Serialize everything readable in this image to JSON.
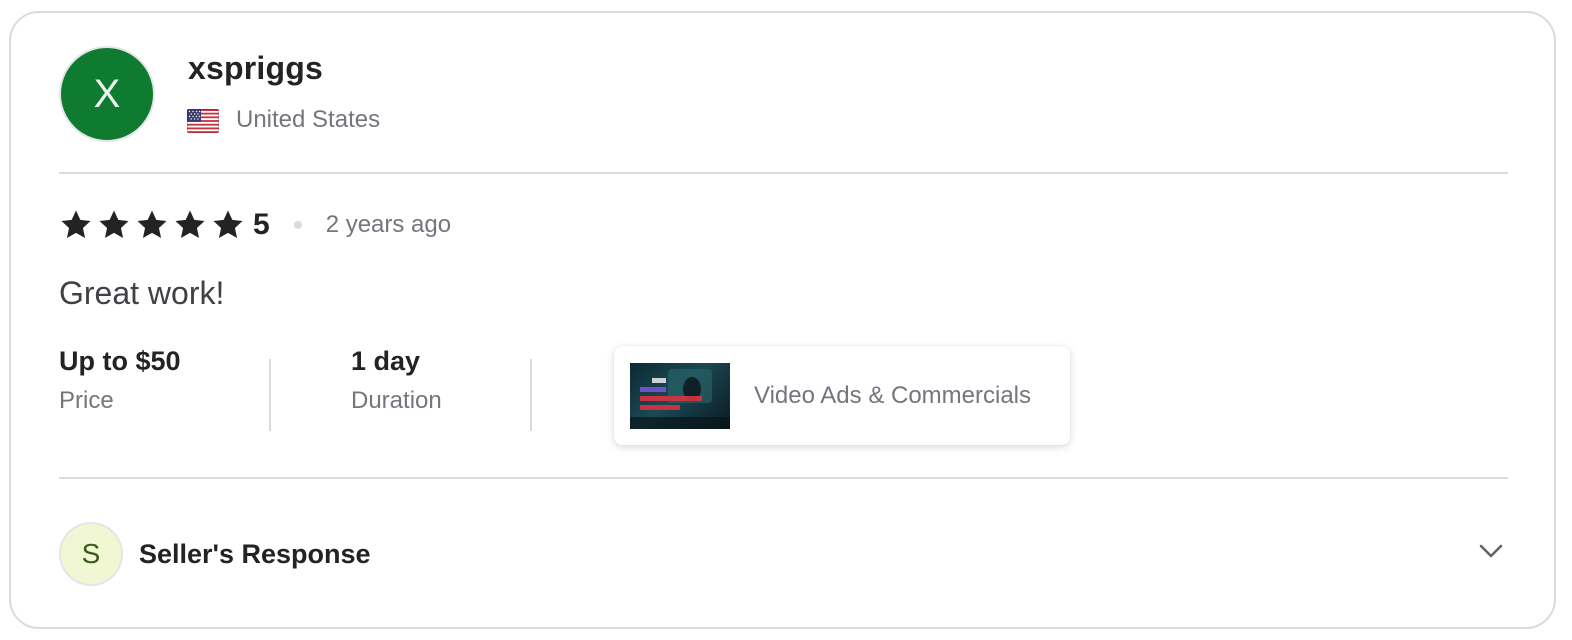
{
  "reviewer": {
    "avatar_letter": "X",
    "username": "xspriggs",
    "country": "United States",
    "flag_icon": "us-flag-icon"
  },
  "review": {
    "star_icon": "star-icon",
    "rating_stars": 5,
    "rating_value": "5",
    "time_ago": "2 years ago",
    "text": "Great work!"
  },
  "details": {
    "price_value": "Up to $50",
    "price_label": "Price",
    "duration_value": "1 day",
    "duration_label": "Duration"
  },
  "gig": {
    "title": "Video Ads & Commercials"
  },
  "seller_response": {
    "avatar_letter": "S",
    "label": "Seller's Response",
    "expand_icon": "chevron-down-icon"
  },
  "colors": {
    "avatar_green": "#0f7b31",
    "star": "#222325",
    "muted_text": "#74767e",
    "border": "#dadbdd"
  }
}
